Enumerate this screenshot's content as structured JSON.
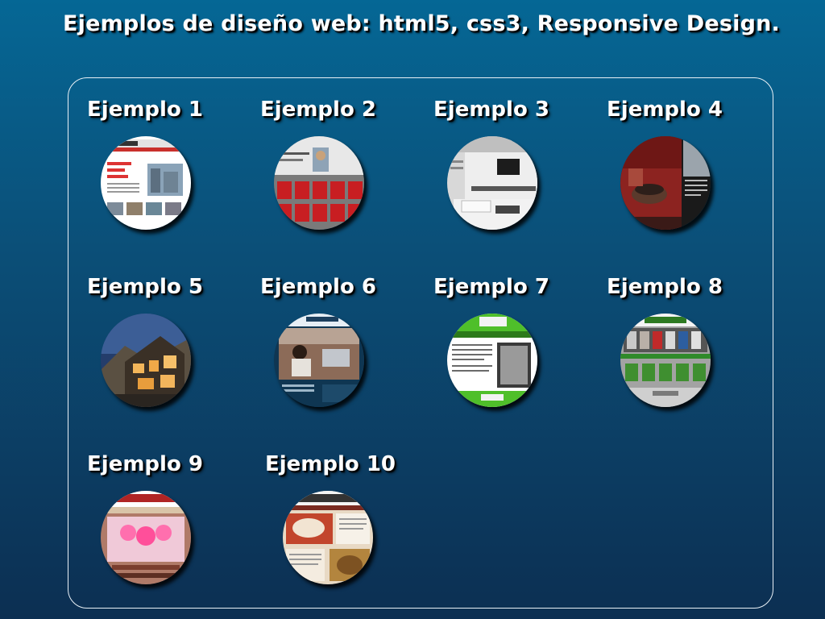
{
  "page": {
    "title": "Ejemplos de diseño web: html5, css3, Responsive Design."
  },
  "examples": [
    {
      "label": "Ejemplo 1",
      "thumb_icon": "website-thumbnail-1"
    },
    {
      "label": "Ejemplo 2",
      "thumb_icon": "website-thumbnail-2"
    },
    {
      "label": "Ejemplo 3",
      "thumb_icon": "website-thumbnail-3"
    },
    {
      "label": "Ejemplo 4",
      "thumb_icon": "website-thumbnail-4"
    },
    {
      "label": "Ejemplo 5",
      "thumb_icon": "website-thumbnail-5"
    },
    {
      "label": "Ejemplo 6",
      "thumb_icon": "website-thumbnail-6"
    },
    {
      "label": "Ejemplo 7",
      "thumb_icon": "website-thumbnail-7"
    },
    {
      "label": "Ejemplo 8",
      "thumb_icon": "website-thumbnail-8"
    },
    {
      "label": "Ejemplo 9",
      "thumb_icon": "website-thumbnail-9"
    },
    {
      "label": "Ejemplo 10",
      "thumb_icon": "website-thumbnail-10"
    }
  ],
  "colors": {
    "background_top": "#056795",
    "background_bottom": "#0c2f52",
    "panel_border": "#e9f0f6",
    "text": "#ffffff"
  }
}
